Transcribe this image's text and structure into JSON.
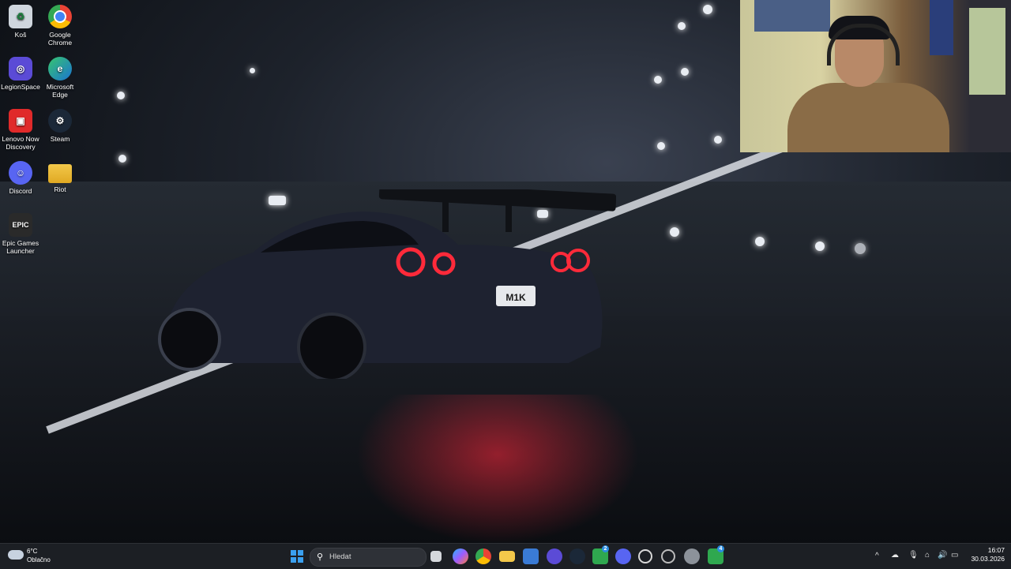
{
  "desktop_icons": [
    {
      "label": "Koš",
      "icon": "recycle-bin-icon"
    },
    {
      "label": "Google Chrome",
      "icon": "chrome-icon"
    },
    {
      "label": "LegionSpace",
      "icon": "legionspace-icon"
    },
    {
      "label": "Microsoft Edge",
      "icon": "edge-icon"
    },
    {
      "label": "Lenovo Now Discovery",
      "icon": "lenovo-now-icon"
    },
    {
      "label": "Steam",
      "icon": "steam-icon"
    },
    {
      "label": "Discord",
      "icon": "discord-icon"
    },
    {
      "label": "Riot",
      "icon": "folder-icon"
    },
    {
      "label": "Epic Games Launcher",
      "icon": "epic-games-icon"
    }
  ],
  "wallpaper": {
    "plate_text": "M1K"
  },
  "taskbar": {
    "weather": {
      "temp": "6°C",
      "condition": "Oblačno"
    },
    "search_placeholder": "Hledat",
    "apps": [
      "start-icon",
      "search-icon",
      "task-view-icon",
      "copilot-icon",
      "chrome-icon",
      "file-explorer-icon",
      "store-icon",
      "legionspace-icon",
      "steam-icon",
      "xbox-icon",
      "discord-icon",
      "settings-gear-icon",
      "legion-icon",
      "gear-icon",
      "xbox-icon"
    ],
    "badges": {
      "xbox_1": "2",
      "xbox_2": "4"
    },
    "tray": {
      "time": "16:07",
      "date": "30.03.2026"
    }
  },
  "colors": {
    "taskbar_bg": "#1c1f24",
    "accent": "#2b8de0",
    "tail_light": "#ff2a3a"
  }
}
